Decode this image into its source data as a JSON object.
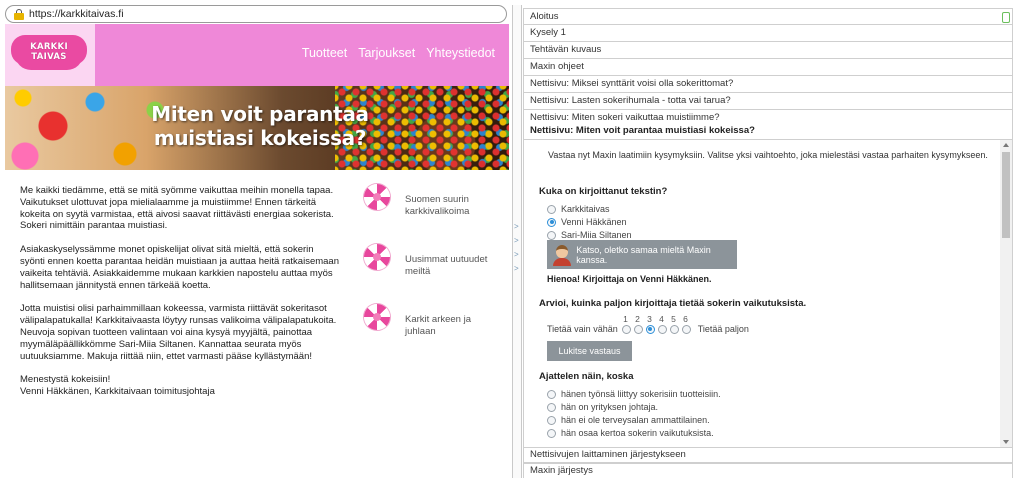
{
  "browser": {
    "url": "https://karkkitaivas.fi"
  },
  "site": {
    "logo_line1": "KARKKI",
    "logo_line2": "TAIVAS",
    "nav": [
      "Tuotteet",
      "Tarjoukset",
      "Yhteystiedot"
    ],
    "hero_title": "Miten voit parantaa muistiasi kokeissa?",
    "paragraphs": [
      "Me kaikki tiedämme, että se mitä syömme vaikuttaa meihin monella tapaa. Vaikutukset ulottuvat jopa mielialaamme ja muistiimme! Ennen tärkeitä kokeita on syytä varmistaa, että aivosi saavat riittävästi energiaa sokerista. Sokeri nimittäin parantaa muistiasi.",
      "Asiakaskyselyssämme monet opiskelijat olivat sitä mieltä, että sokerin syönti ennen koetta parantaa heidän muistiaan ja auttaa heitä ratkaisemaan vaikeita tehtäviä. Asiakkaidemme mukaan karkkien napostelu auttaa myös hallitsemaan jännitystä ennen tärkeää koetta.",
      "Jotta muistisi olisi parhaimmillaan kokeessa, varmista riittävät sokeritasot välipalapatukalla! Karkkitaivaasta löytyy runsas valikoima välipalapatukoita. Neuvoja sopivan tuotteen valintaan voi aina kysyä myyjältä, painottaa myymäläpäällikkömme Sari-Miia Siltanen. Kannattaa seurata myös uutuuksiamme. Makuja riittää niin, ettet varmasti pääse kyllästymään!",
      "Menestystä kokeisiin!",
      "Venni Häkkänen, Karkkitaivaan toimitusjohtaja"
    ],
    "side_items": [
      "Suomen suurin karkkivalikoima",
      "Uusimmat uutuudet meiltä",
      "Karkit arkeen ja juhlaan"
    ]
  },
  "survey": {
    "sections": [
      "Aloitus",
      "Kysely 1",
      "Tehtävän kuvaus",
      "Maxin ohjeet",
      "Nettisivu: Miksei synttärit voisi olla sokerittomat?",
      "Nettisivu: Lasten sokerihumala - totta vai tarua?",
      "Nettisivu: Miten sokeri vaikuttaa muistiimme?",
      "Nettisivu: Miten voit parantaa muistiasi kokeissa?"
    ],
    "intro": "Vastaa nyt Maxin laatimiin kysymyksiin. Valitse yksi vaihtoehto, joka mielestäsi vastaa parhaiten kysymykseen.",
    "q1": {
      "title": "Kuka on kirjoittanut tekstin?",
      "options": [
        "Karkkitaivas",
        "Venni Häkkänen",
        "Sari-Miia Siltanen"
      ],
      "selected_index": 1
    },
    "maxin_button": "Katso, oletko samaa mieltä Maxin kanssa.",
    "feedback": "Hienoa! Kirjoittaja on Venni Häkkänen.",
    "q2": {
      "title": "Arvioi, kuinka paljon kirjoittaja tietää sokerin vaikutuksista.",
      "scale": [
        "1",
        "2",
        "3",
        "4",
        "5",
        "6"
      ],
      "left_label": "Tietää vain vähän",
      "right_label": "Tietää paljon",
      "selected_value": 3
    },
    "lock_button": "Lukitse vastaus",
    "q3": {
      "title": "Ajattelen näin, koska",
      "options": [
        "hänen työnsä liittyy sokerisiin tuotteisiin.",
        "hän on yrityksen johtaja.",
        "hän ei ole terveysalan ammattilainen.",
        "hän osaa kertoa sokerin vaikutuksista."
      ]
    },
    "bottom_sections": [
      "Nettisivujen laittaminen järjestykseen",
      "Maxin järjestys"
    ]
  },
  "colors": {
    "header_pink": "#ef88d8",
    "logo_pink": "#ea4aa2",
    "button_gray": "#8c949a",
    "radio_blue": "#2d8fd8"
  }
}
